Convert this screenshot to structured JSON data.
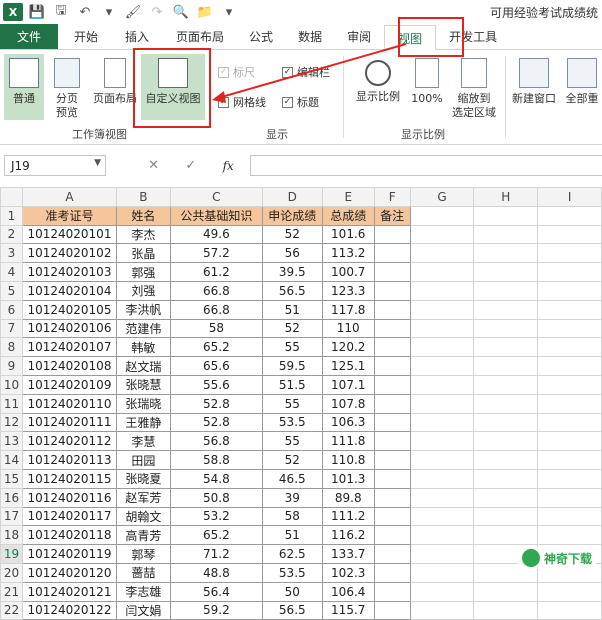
{
  "title_bar": {
    "doc_title": "可用经验考试成绩统"
  },
  "tabs": [
    {
      "label": "文件"
    },
    {
      "label": "开始"
    },
    {
      "label": "插入"
    },
    {
      "label": "页面布局"
    },
    {
      "label": "公式"
    },
    {
      "label": "数据"
    },
    {
      "label": "审阅"
    },
    {
      "label": "视图"
    },
    {
      "label": "开发工具"
    }
  ],
  "active_tab": "视图",
  "ribbon": {
    "normal": "普通",
    "page_break_1": "分页",
    "page_break_2": "预览",
    "page_layout": "页面布局",
    "custom_view": "自定义视图",
    "ruler": "标尺",
    "formula_bar": "编辑栏",
    "gridlines": "网格线",
    "headings": "标题",
    "zoom": "显示比例",
    "zoom100": "100%",
    "zoom_sel_1": "缩放到",
    "zoom_sel_2": "选定区域",
    "new_window": "新建窗口",
    "arrange_all": "全部重",
    "group_workbook_views": "工作簿视图",
    "group_show": "显示",
    "group_zoom": "显示比例"
  },
  "formula_bar": {
    "name_box": "J19",
    "fx": "fx"
  },
  "columns": [
    "A",
    "B",
    "C",
    "D",
    "E",
    "F",
    "G",
    "H",
    "I"
  ],
  "headers": [
    "准考证号",
    "姓名",
    "公共基础知识",
    "申论成绩",
    "总成绩",
    "备注"
  ],
  "rows": [
    [
      "1",
      "",
      "",
      "",
      "",
      "",
      ""
    ],
    [
      "2",
      "10124020101",
      "李杰",
      "49.6",
      "52",
      "101.6",
      ""
    ],
    [
      "3",
      "10124020102",
      "张晶",
      "57.2",
      "56",
      "113.2",
      ""
    ],
    [
      "4",
      "10124020103",
      "郭强",
      "61.2",
      "39.5",
      "100.7",
      ""
    ],
    [
      "5",
      "10124020104",
      "刘强",
      "66.8",
      "56.5",
      "123.3",
      ""
    ],
    [
      "6",
      "10124020105",
      "李洪帆",
      "66.8",
      "51",
      "117.8",
      ""
    ],
    [
      "7",
      "10124020106",
      "范建伟",
      "58",
      "52",
      "110",
      ""
    ],
    [
      "8",
      "10124020107",
      "韩敏",
      "65.2",
      "55",
      "120.2",
      ""
    ],
    [
      "9",
      "10124020108",
      "赵文瑞",
      "65.6",
      "59.5",
      "125.1",
      ""
    ],
    [
      "10",
      "10124020109",
      "张晓慧",
      "55.6",
      "51.5",
      "107.1",
      ""
    ],
    [
      "11",
      "10124020110",
      "张瑞晓",
      "52.8",
      "55",
      "107.8",
      ""
    ],
    [
      "12",
      "10124020111",
      "王雅静",
      "52.8",
      "53.5",
      "106.3",
      ""
    ],
    [
      "13",
      "10124020112",
      "李慧",
      "56.8",
      "55",
      "111.8",
      ""
    ],
    [
      "14",
      "10124020113",
      "田园",
      "58.8",
      "52",
      "110.8",
      ""
    ],
    [
      "15",
      "10124020115",
      "张晓夏",
      "54.8",
      "46.5",
      "101.3",
      ""
    ],
    [
      "16",
      "10124020116",
      "赵军芳",
      "50.8",
      "39",
      "89.8",
      ""
    ],
    [
      "17",
      "10124020117",
      "胡翰文",
      "53.2",
      "58",
      "111.2",
      ""
    ],
    [
      "18",
      "10124020118",
      "高青芳",
      "65.2",
      "51",
      "116.2",
      ""
    ],
    [
      "19",
      "10124020119",
      "郭琴",
      "71.2",
      "62.5",
      "133.7",
      ""
    ],
    [
      "20",
      "10124020120",
      "蔷喆",
      "48.8",
      "53.5",
      "102.3",
      ""
    ],
    [
      "21",
      "10124020121",
      "李志雄",
      "56.4",
      "50",
      "106.4",
      ""
    ],
    [
      "22",
      "10124020122",
      "闫文娟",
      "59.2",
      "56.5",
      "115.7",
      ""
    ]
  ],
  "selected_row": "19",
  "watermark": {
    "text": "神奇下载"
  },
  "colors": {
    "accent": "#217346",
    "highlight": "#e0261c",
    "header_fill": "#f5c69c"
  }
}
